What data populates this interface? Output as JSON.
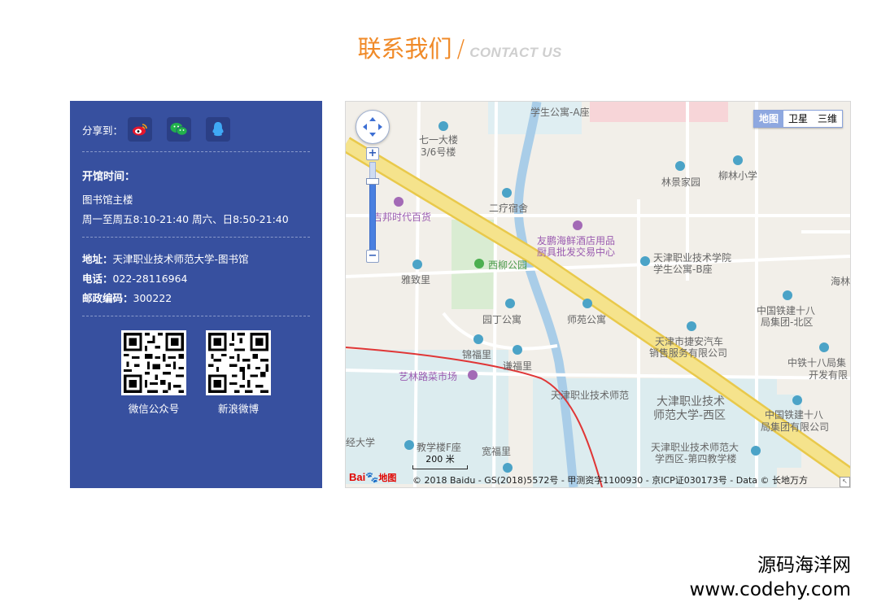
{
  "title": {
    "cn": "联系我们",
    "sep": "/",
    "en": "CONTACT US"
  },
  "share": {
    "label": "分享到：",
    "icons": [
      "weibo-icon",
      "wechat-icon",
      "qq-icon"
    ]
  },
  "hours": {
    "title": "开馆时间：",
    "building": "图书馆主楼",
    "schedule": "周一至周五8:10-21:40 周六、日8:50-21:40"
  },
  "contact": {
    "address_label": "地址：",
    "address": "天津职业技术师范大学-图书馆",
    "phone_label": "电话：",
    "phone": "022-28116964",
    "postcode_label": "邮政编码：",
    "postcode": "300222"
  },
  "qr": {
    "wechat_caption": "微信公众号",
    "weibo_caption": "新浪微博"
  },
  "map": {
    "types": [
      "地图",
      "卫星",
      "三维"
    ],
    "active_type": "地图",
    "scale": "200 米",
    "copyright": "© 2018 Baidu - GS(2018)5572号 - 甲测资字1100930 - 京ICP证030173号 - Data © 长地万方",
    "logo": "Bai",
    "logo_suffix": "地图",
    "labels": [
      "学生公寓-A座",
      "七一大楼",
      "3/6号楼",
      "林景家园",
      "柳林小学",
      "二疗宿舍",
      "吉邦时代百货",
      "友鹏海鲜酒店用品",
      "厨具批发交易中心",
      "天津职业技术学院",
      "学生公寓-B座",
      "西柳公园",
      "雅致里",
      "海林",
      "园丁公寓",
      "师苑公寓",
      "中国铁建十八",
      "局集团-北区",
      "天津市捷安汽车",
      "销售服务有限公司",
      "锦福里",
      "谦福里",
      "中铁十八局集",
      "开发有限",
      "艺林路菜市场",
      "天津职业技术师范",
      "大津职业技术",
      "师范大学-西区",
      "中国铁建十八",
      "局集团有限公司",
      "经大学",
      "教学楼F座",
      "宽福里",
      "天津职业技术师范大",
      "学西区-第四教学楼"
    ]
  },
  "watermark": {
    "line1": "源码海洋网",
    "line2": "www.codehy.com"
  }
}
